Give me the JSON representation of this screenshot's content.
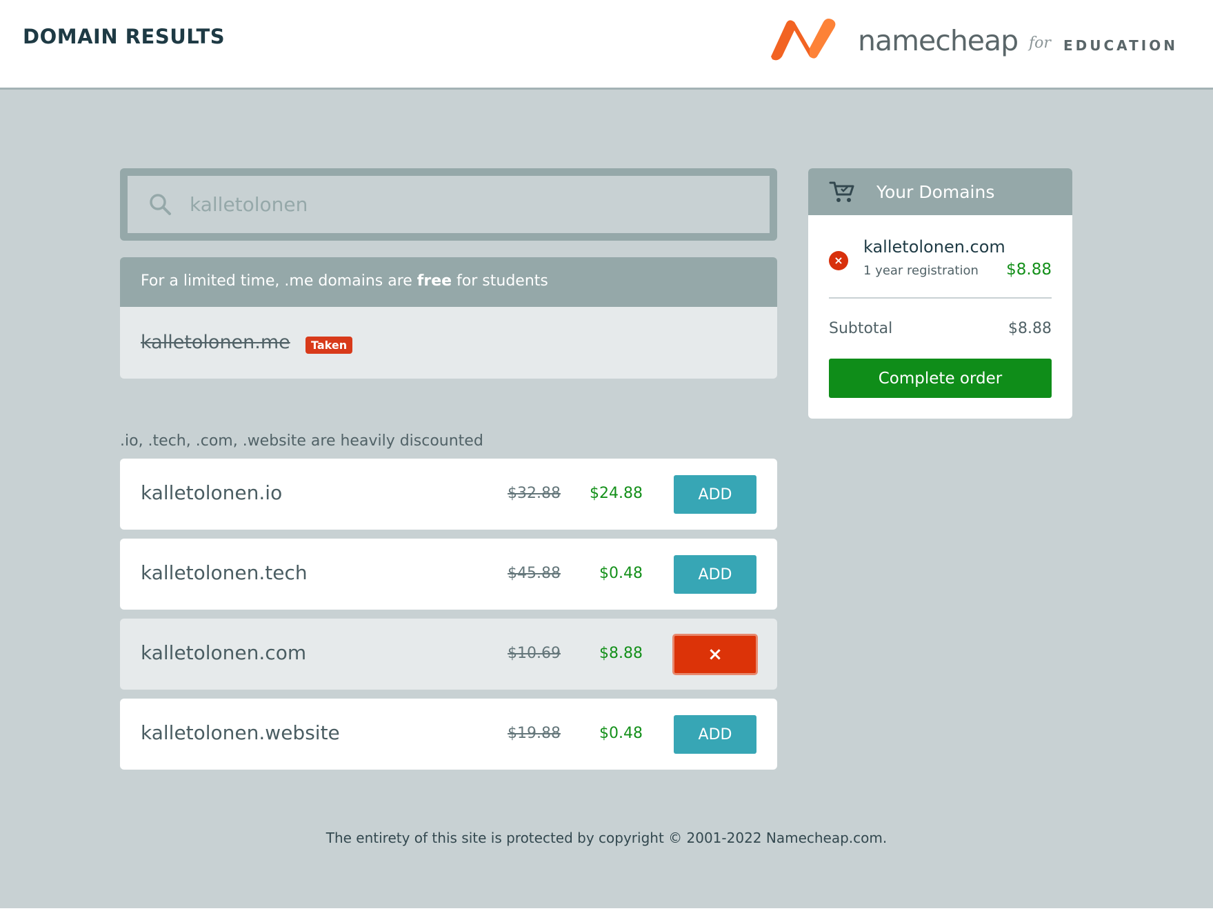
{
  "header": {
    "title": "DOMAIN RESULTS",
    "brand_name": "namecheap",
    "brand_for": "for",
    "brand_edu": "EDUCATION"
  },
  "search": {
    "value": "kalletolonen",
    "placeholder": "kalletolonen"
  },
  "promo": {
    "text_before": "For a limited time, .me domains are ",
    "text_bold": "free",
    "text_after": " for students",
    "domain": "kalletolonen.me",
    "badge": "Taken"
  },
  "discount_label": ".io, .tech, .com, .website are heavily discounted",
  "domains": [
    {
      "name": "kalletolonen.io",
      "old_price": "$32.88",
      "new_price": "$24.88",
      "action": "ADD",
      "selected": false
    },
    {
      "name": "kalletolonen.tech",
      "old_price": "$45.88",
      "new_price": "$0.48",
      "action": "ADD",
      "selected": false
    },
    {
      "name": "kalletolonen.com",
      "old_price": "$10.69",
      "new_price": "$8.88",
      "action": "×",
      "selected": true
    },
    {
      "name": "kalletolonen.website",
      "old_price": "$19.88",
      "new_price": "$0.48",
      "action": "ADD",
      "selected": false
    }
  ],
  "cart": {
    "title": "Your Domains",
    "item": {
      "domain": "kalletolonen.com",
      "term": "1 year registration",
      "price": "$8.88",
      "remove_glyph": "×"
    },
    "subtotal_label": "Subtotal",
    "subtotal_value": "$8.88",
    "complete_label": "Complete order"
  },
  "footer": {
    "copyright": "The entirety of this site is protected by copyright © 2001-2022 Namecheap.com."
  },
  "colors": {
    "accent_teal": "#37a6b5",
    "brand_orange": "#f26322",
    "success_green": "#0f8d19",
    "danger_red": "#dc3308"
  }
}
